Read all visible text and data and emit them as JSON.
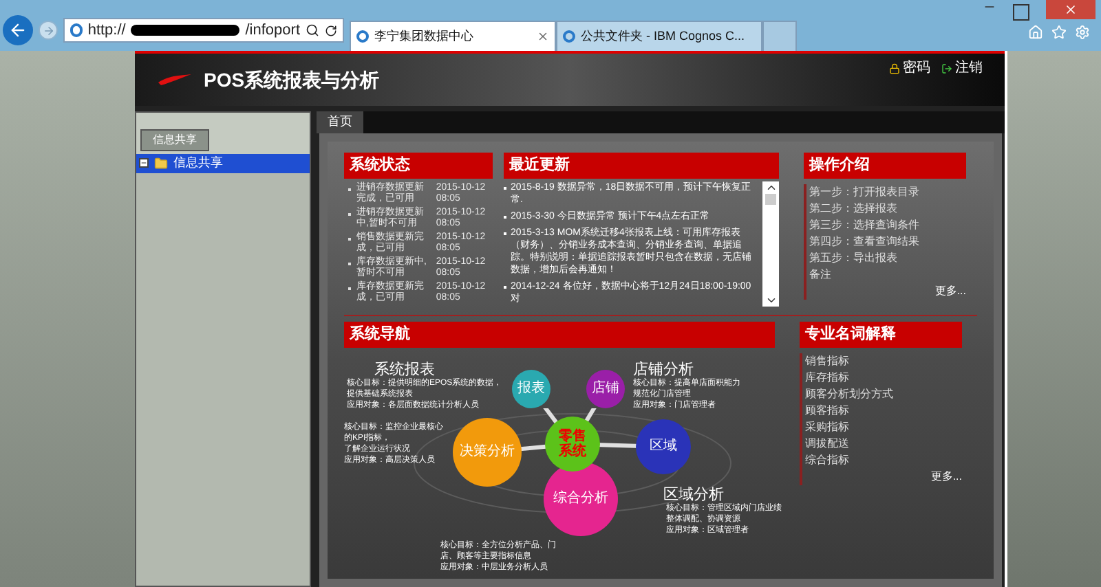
{
  "browser": {
    "url": "http://",
    "url_tail": "/infoport",
    "tabs": [
      {
        "title": "李宁集团数据中心",
        "selected": true
      },
      {
        "title": "公共文件夹 - IBM Cognos C...",
        "selected": false
      }
    ]
  },
  "header": {
    "logo_text": "POS系统报表与分析",
    "links": [
      {
        "kind": "lock",
        "label": "密码"
      },
      {
        "kind": "exit",
        "label": "注销"
      }
    ]
  },
  "sidebar": {
    "tab": "信息共享",
    "tree": [
      {
        "label": "信息共享",
        "selected": true,
        "expanded": true
      }
    ]
  },
  "page_tabs": [
    {
      "label": "首页",
      "selected": true
    }
  ],
  "status": {
    "title": "系统状态",
    "items": [
      {
        "text": "进销存数据更新完成，已可用",
        "time": "2015-10-12 08:05"
      },
      {
        "text": "进销存数据更新中,暂时不可用",
        "time": "2015-10-12 08:05"
      },
      {
        "text": "销售数据更新完成，已可用",
        "time": "2015-10-12 08:05"
      },
      {
        "text": "库存数据更新中,暂时不可用",
        "time": "2015-10-12 08:05"
      },
      {
        "text": "库存数据更新完成，已可用",
        "time": "2015-10-12 08:05"
      }
    ]
  },
  "news": {
    "title": "最近更新",
    "items": [
      "2015-8-19  数据异常，18日数据不可用，预计下午恢复正常.",
      "2015-3-30  今日数据异常 预计下午4点左右正常",
      "2015-3-13  MOM系统迁移4张报表上线：可用库存报表（财务）、分销业务成本查询、分销业务查询、单据追踪。特别说明：单据追踪报表暂时只包含在数据，无店铺数据，增加后会再通知！",
      "2014-12-24  各位好，数据中心将于12月24日18:00-19:00对"
    ]
  },
  "guide": {
    "title": "操作介绍",
    "items": [
      "第一步：打开报表目录",
      "第二步：选择报表",
      "第三步：选择查询条件",
      "第四步：查看查询结果",
      "第五步：导出报表",
      "备注"
    ],
    "more": "更多..."
  },
  "nav": {
    "title": "系统导航",
    "center": "零售系统",
    "nodes": [
      {
        "label": "报表",
        "title": "系统报表",
        "lines": [
          "核心目标：提供明细的EPOS系统的数据，",
          "提供基础系统报表",
          "应用对象：各层面数据统计分析人员"
        ],
        "color": "#2aa9b0"
      },
      {
        "label": "店铺",
        "title": "店铺分析",
        "lines": [
          "核心目标：提高单店面积能力",
          "规范化门店管理",
          "应用对象：门店管理者"
        ],
        "color": "#9a1fa8"
      },
      {
        "label": "决策分析",
        "lines": [
          "核心目标：监控企业最核心",
          "的KPI指标，",
          "了解企业运行状况",
          "应用对象：高层决策人员"
        ],
        "color": "#f29a0c"
      },
      {
        "label": "区域",
        "title": "区域分析",
        "lines": [
          "核心目标：管理区域内门店业绩",
          "整体调配、协调资源",
          "应用对象：区域管理者"
        ],
        "color": "#2a33b8"
      },
      {
        "label": "综合分析",
        "lines": [
          "核心目标：全方位分析产品、门",
          "店、顾客等主要指标信息",
          "应用对象：中层业务分析人员"
        ],
        "color": "#e5258f"
      }
    ]
  },
  "glossary": {
    "title": "专业名词解释",
    "items": [
      "销售指标",
      "库存指标",
      "顾客分析划分方式",
      "顾客指标",
      "采购指标",
      "调拔配送",
      "综合指标"
    ],
    "more": "更多..."
  }
}
